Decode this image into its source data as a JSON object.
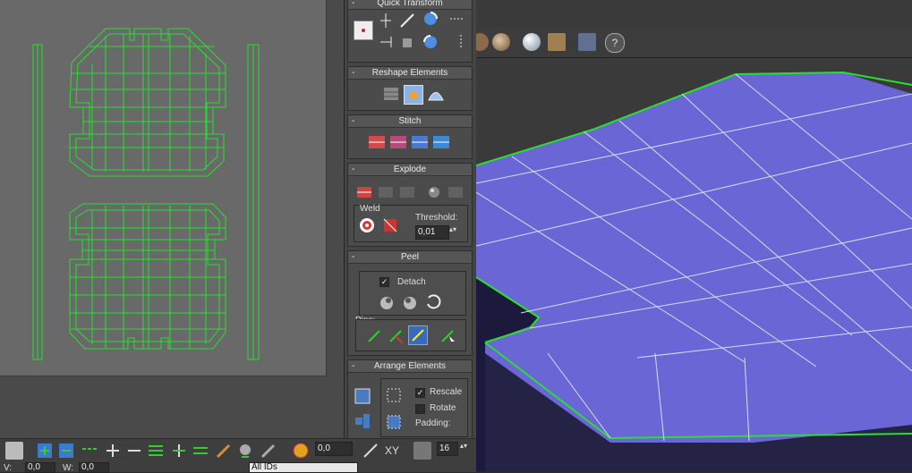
{
  "panel": {
    "quick_transform": {
      "title": "Quick Transform"
    },
    "reshape": {
      "title": "Reshape Elements"
    },
    "stitch": {
      "title": "Stitch"
    },
    "explode": {
      "title": "Explode",
      "weld_label": "Weld",
      "threshold_label": "Threshold:",
      "threshold_value": "0,01"
    },
    "peel": {
      "title": "Peel",
      "detach_label": "Detach",
      "detach_checked": true,
      "pins_label": "Pins:"
    },
    "arrange": {
      "title": "Arrange Elements",
      "rescale_label": "Rescale",
      "rescale_checked": true,
      "rotate_label": "Rotate",
      "rotate_checked": false,
      "padding_label": "Padding:"
    }
  },
  "bottom": {
    "value_field": "0,0",
    "xy_label": "XY",
    "count_field": "16",
    "select_value": "All IDs",
    "v_label": "V:",
    "v_value": "0,0",
    "w_label": "W:",
    "w_value": "0,0"
  },
  "colors": {
    "wire": "#28e02e",
    "surface": "#6a66d6",
    "canvas": "#696969"
  }
}
